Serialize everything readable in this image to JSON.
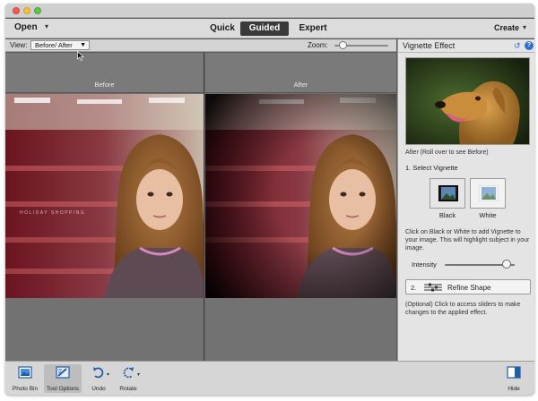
{
  "menu": {
    "open_label": "Open",
    "modes": [
      "Quick",
      "Guided",
      "Expert"
    ],
    "active_mode": "Guided",
    "create_label": "Create"
  },
  "options": {
    "view_label": "View:",
    "view_value": "Before/ After",
    "zoom_label": "Zoom:"
  },
  "canvas": {
    "before_label": "Before",
    "after_label": "After",
    "photo_caption": "HOLIDAY SHOPPING"
  },
  "panel": {
    "title": "Vignette Effect",
    "preview_caption": "After (Roll over to see Before)",
    "step1": "1. Select Vignette",
    "black_label": "Black",
    "white_label": "White",
    "instructions": "Click on Black or White to add Vignette to your image. This will highlight subject in your image.",
    "intensity_label": "Intensity",
    "intensity_value": 0.88,
    "refine_number": "2.",
    "refine_label": "Refine Shape",
    "optional_text": "(Optional) Click to access sliders to make changes to the applied effect."
  },
  "bottombar": {
    "photo_bin": "Photo Bin",
    "tool_options": "Tool Options",
    "undo": "Undo",
    "rotate": "Rotate",
    "hide": "Hide"
  },
  "colors": {
    "accent": "#2f6fd0",
    "active_tab": "#3a3a3a"
  }
}
